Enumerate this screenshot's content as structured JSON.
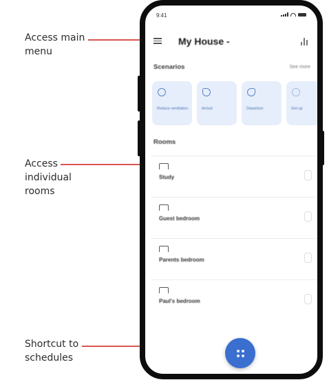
{
  "callouts": {
    "menu": [
      "Access main",
      "menu"
    ],
    "rooms": [
      "Access",
      "individual",
      "rooms"
    ],
    "schedules": [
      "Shortcut to",
      "schedules"
    ],
    "accent_color": "#d9534f"
  },
  "status_bar": {
    "time": "9:41"
  },
  "header": {
    "title": "My House -"
  },
  "scenarios": {
    "label": "Scenarios",
    "see_more": "See more",
    "items": [
      {
        "label": "Reduce ventilation",
        "icon": "fan-icon"
      },
      {
        "label": "Arrival",
        "icon": "home-arrive-icon"
      },
      {
        "label": "Departure",
        "icon": "home-leave-icon"
      },
      {
        "label": "Get up",
        "icon": "sun-icon"
      }
    ]
  },
  "rooms": {
    "label": "Rooms",
    "items": [
      {
        "label": "Study"
      },
      {
        "label": "Guest bedroom"
      },
      {
        "label": "Parents bedroom"
      },
      {
        "label": "Paul's bedroom"
      }
    ]
  },
  "colors": {
    "fab": "#3a6fd0",
    "card_bg": "#e6eefb",
    "card_text": "#4a6fb0"
  }
}
